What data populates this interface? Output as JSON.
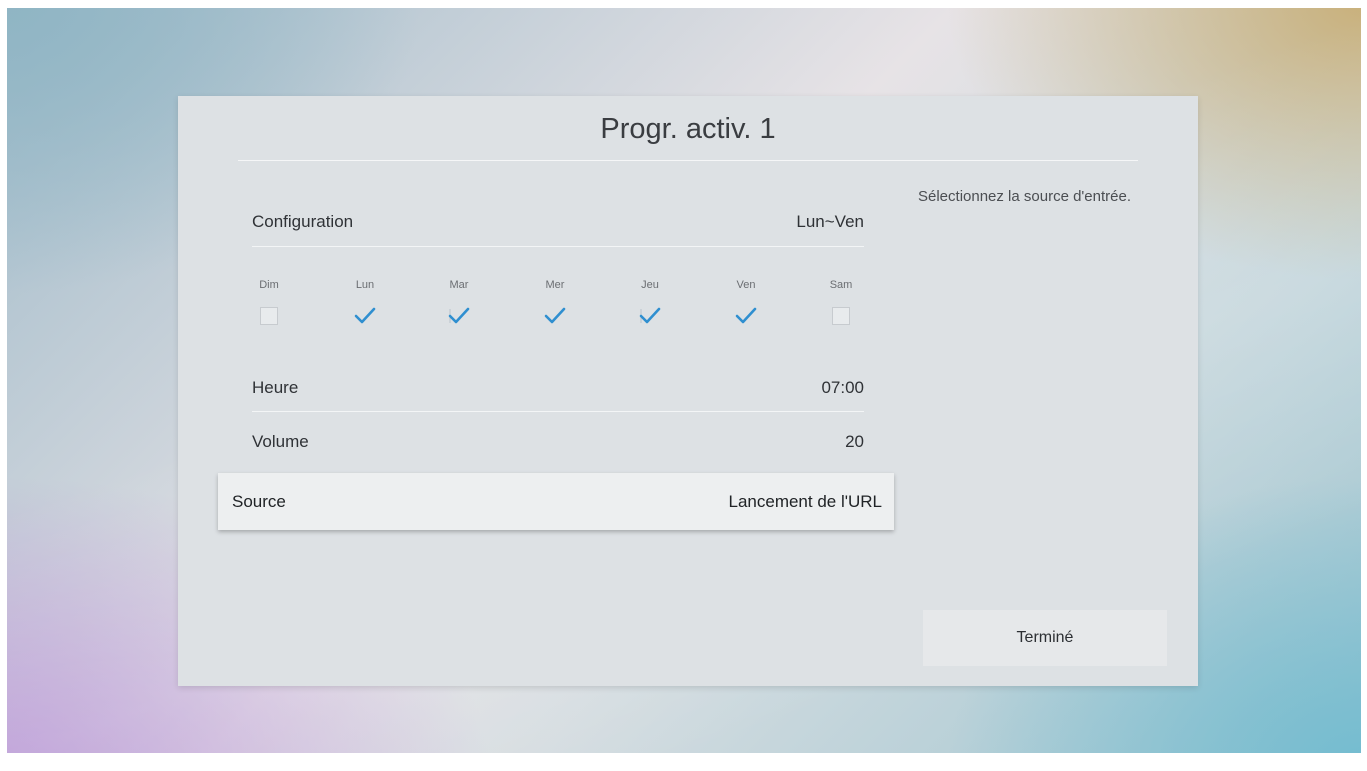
{
  "dialog": {
    "title": "Progr. activ. 1",
    "help_text": "Sélectionnez la source d'entrée.",
    "done_label": "Terminé"
  },
  "settings": {
    "configuration": {
      "label": "Configuration",
      "value": "Lun~Ven"
    },
    "heure": {
      "label": "Heure",
      "value": "07:00"
    },
    "volume": {
      "label": "Volume",
      "value": "20"
    },
    "source": {
      "label": "Source",
      "value": "Lancement de l'URL"
    }
  },
  "days": [
    {
      "label": "Dim",
      "checked": false
    },
    {
      "label": "Lun",
      "checked": true
    },
    {
      "label": "Mar",
      "checked": true
    },
    {
      "label": "Mer",
      "checked": true
    },
    {
      "label": "Jeu",
      "checked": true
    },
    {
      "label": "Ven",
      "checked": true
    },
    {
      "label": "Sam",
      "checked": false
    }
  ],
  "colors": {
    "check": "#2f8fd0",
    "selected_row": "#edeff0",
    "dialog": "#dde1e4"
  }
}
